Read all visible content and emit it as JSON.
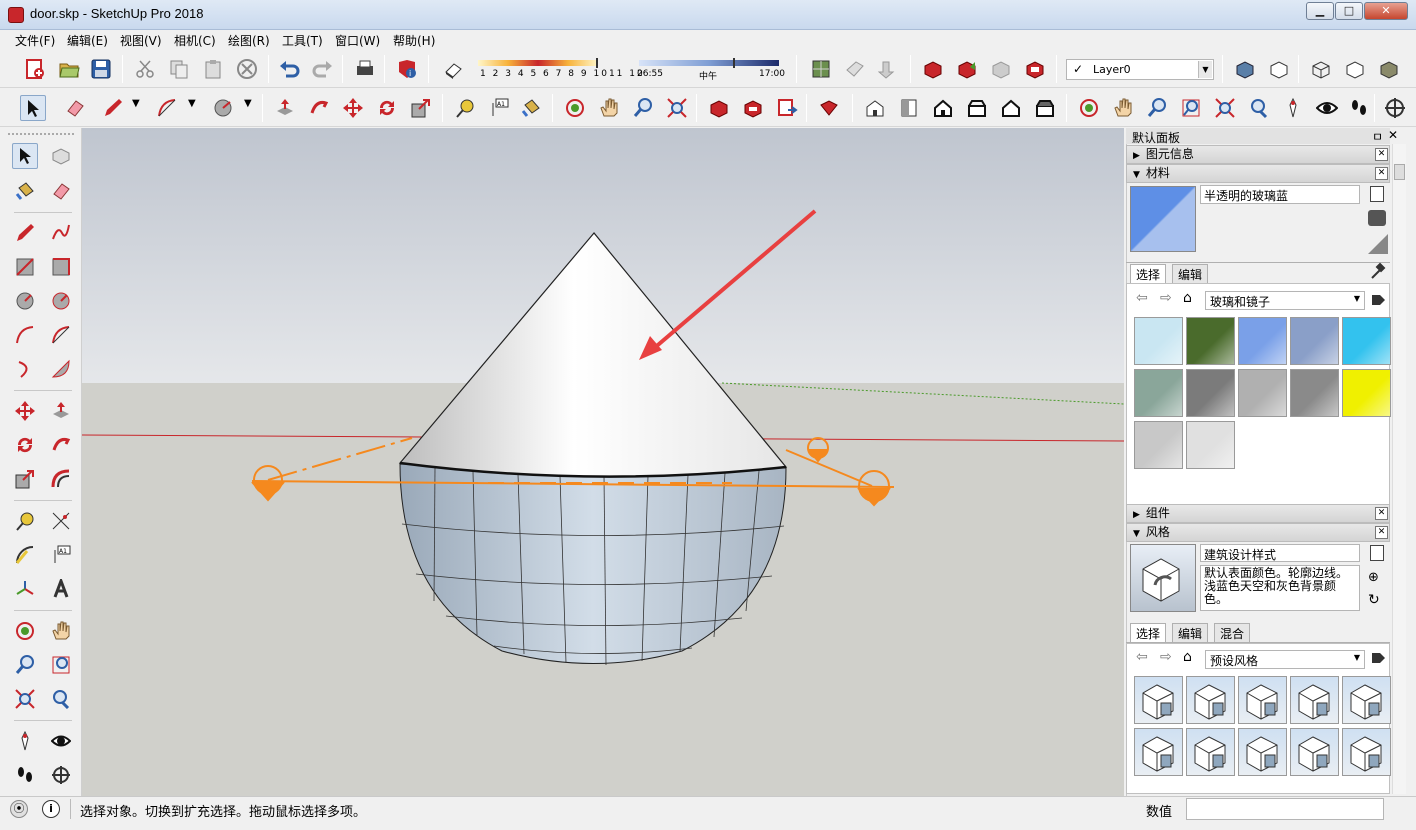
{
  "window": {
    "title": "door.skp - SketchUp Pro 2018",
    "minimize": "▁",
    "maximize": "□",
    "close": "✕"
  },
  "menu": [
    "文件(F)",
    "编辑(E)",
    "视图(V)",
    "相机(C)",
    "绘图(R)",
    "工具(T)",
    "窗口(W)",
    "帮助(H)"
  ],
  "shadow": {
    "months": [
      "1",
      "2",
      "3",
      "4",
      "5",
      "6",
      "7",
      "8",
      "9",
      "10",
      "11",
      "12"
    ],
    "time_start": "06:55",
    "time_mid": "中午",
    "time_end": "17:00"
  },
  "layer": {
    "check": "✓",
    "name": "Layer0"
  },
  "default_panel": {
    "title": "默认面板",
    "pin": "ㅁ",
    "close": "✕"
  },
  "entity_info": {
    "title": "图元信息"
  },
  "materials": {
    "title": "材料",
    "current_name": "半透明的玻璃蓝",
    "tabs": [
      "选择",
      "编辑"
    ],
    "library": "玻璃和镜子",
    "swatches": [
      "#c9e6f2",
      "#4a6b2c",
      "#7aa0e8",
      "#8a9fc8",
      "#33c2ee",
      "#8aa69a",
      "#7b7b7b",
      "#b0b0b0",
      "#8a8a8a",
      "#f0f000",
      "#c8c8c8",
      "#e0e0e0"
    ]
  },
  "components": {
    "title": "组件"
  },
  "styles": {
    "title": "风格",
    "name": "建筑设计样式",
    "description": "默认表面颜色。轮廓边线。浅蓝色天空和灰色背景颜色。",
    "tabs": [
      "选择",
      "编辑",
      "混合"
    ],
    "library": "预设风格"
  },
  "status": {
    "hint": "选择对象。切换到扩充选择。拖动鼠标选择多项。",
    "measure_label": "数值",
    "measure_value": ""
  },
  "colors": {
    "accent_red": "#c8262b",
    "selection_orange": "#f5891e",
    "arrow_red": "#e84040"
  }
}
